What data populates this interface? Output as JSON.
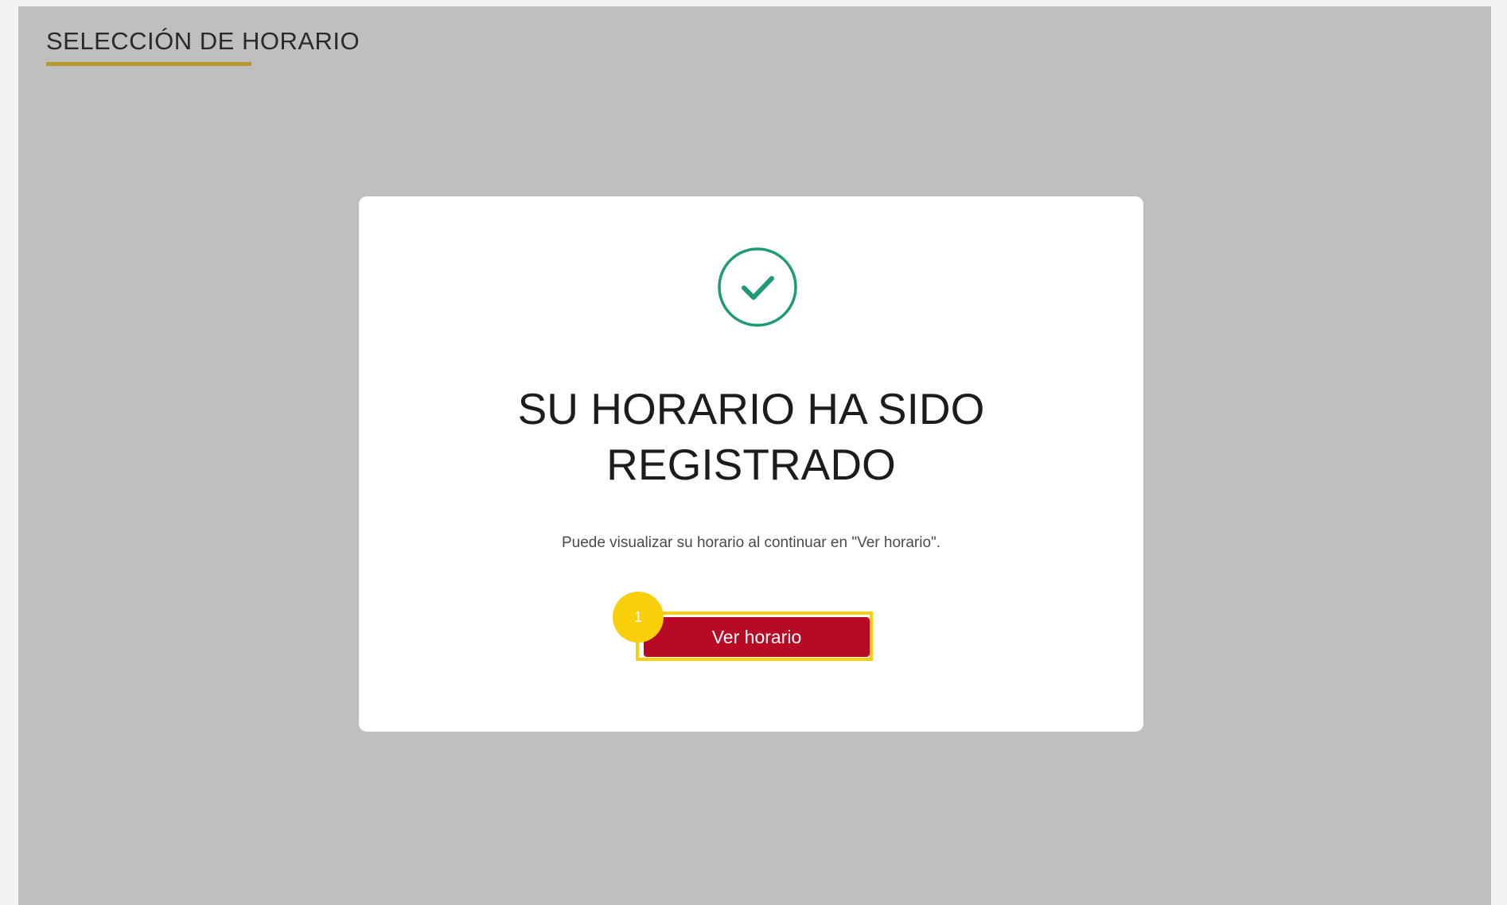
{
  "page": {
    "title": "SELECCIÓN DE HORARIO"
  },
  "modal": {
    "heading_line1": "SU HORARIO HA SIDO",
    "heading_line2": "REGISTRADO",
    "message": "Puede visualizar su horario al continuar en \"Ver horario\".",
    "success_icon": "check-circle-icon",
    "button_label": "Ver horario"
  },
  "annotation": {
    "step_number": "1"
  },
  "colors": {
    "background": "#bfbfbf",
    "accent_underline": "#b9982f",
    "success": "#1f9a78",
    "button": "#b80a25",
    "highlight": "#f5cf0a"
  }
}
